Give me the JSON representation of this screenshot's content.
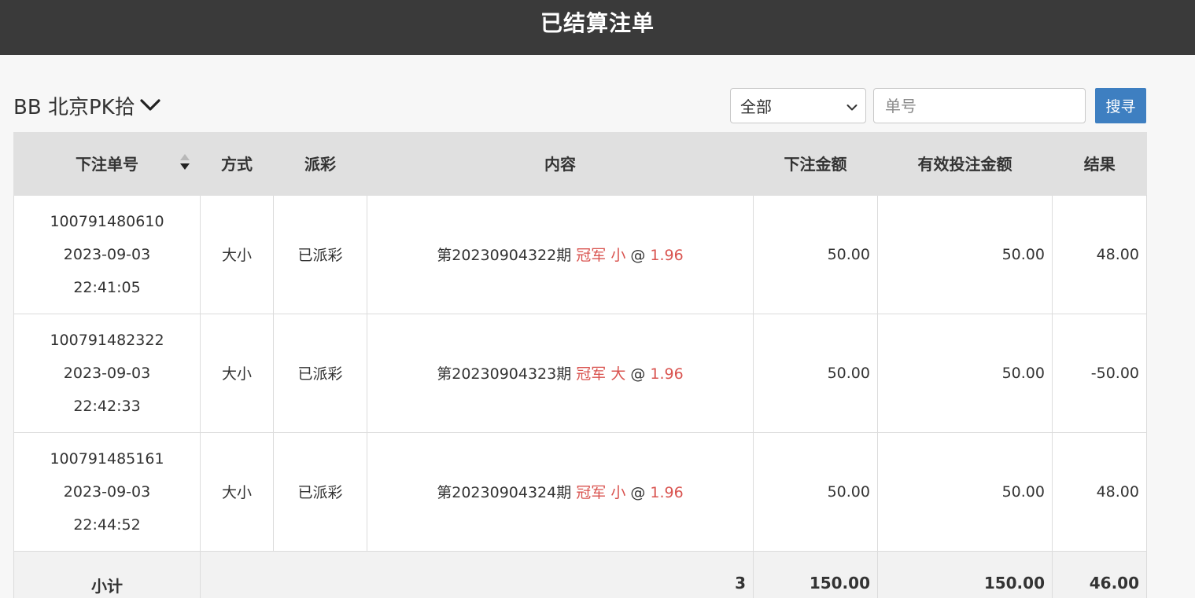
{
  "header": {
    "title": "已结算注单"
  },
  "game_selector": {
    "label": "BB 北京PK拾",
    "icon": "chevron-down-icon"
  },
  "filter": {
    "selected": "全部"
  },
  "search": {
    "placeholder": "单号",
    "button_label": "搜寻"
  },
  "table": {
    "columns": [
      "下注单号",
      "方式",
      "派彩",
      "内容",
      "下注金额",
      "有效投注金额",
      "结果"
    ],
    "rows": [
      {
        "order_no": "100791480610",
        "date": "2023-09-03",
        "time": "22:41:05",
        "method": "大小",
        "payout": "已派彩",
        "issue": "第20230904322期",
        "pick": "冠军 小",
        "at": "@",
        "odds": "1.96",
        "bet": "50.00",
        "valid": "50.00",
        "result": "48.00"
      },
      {
        "order_no": "100791482322",
        "date": "2023-09-03",
        "time": "22:42:33",
        "method": "大小",
        "payout": "已派彩",
        "issue": "第20230904323期",
        "pick": "冠军 大",
        "at": "@",
        "odds": "1.96",
        "bet": "50.00",
        "valid": "50.00",
        "result": "-50.00"
      },
      {
        "order_no": "100791485161",
        "date": "2023-09-03",
        "time": "22:44:52",
        "method": "大小",
        "payout": "已派彩",
        "issue": "第20230904324期",
        "pick": "冠军 小",
        "at": "@",
        "odds": "1.96",
        "bet": "50.00",
        "valid": "50.00",
        "result": "48.00"
      }
    ],
    "subtotal": {
      "label": "小计",
      "count": "3",
      "bet": "150.00",
      "valid": "150.00",
      "result": "46.00"
    }
  },
  "colors": {
    "header_bg": "#3a3a3a",
    "accent_red": "#d9534f",
    "button_blue": "#3e7fc1"
  }
}
